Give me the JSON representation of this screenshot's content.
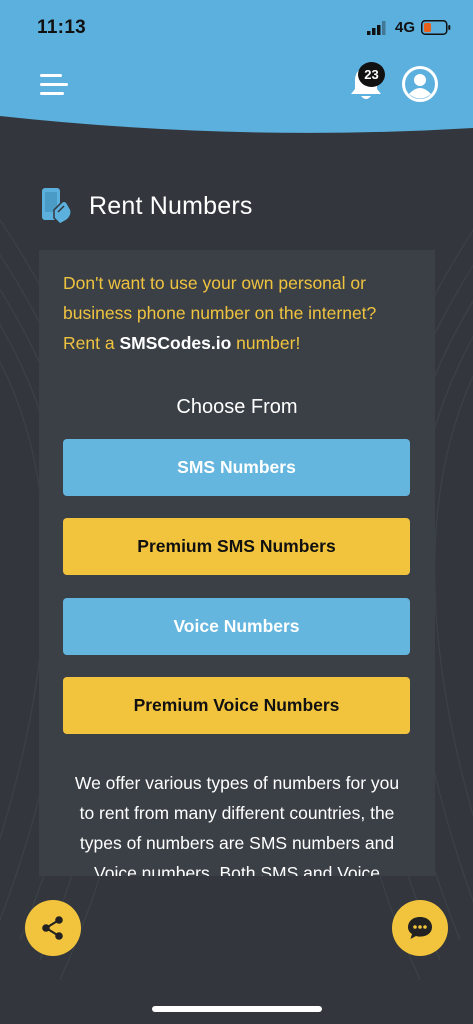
{
  "status_bar": {
    "time": "11:13",
    "network": "4G"
  },
  "header": {
    "notification_count": "23",
    "accent_color": "#5cb0dd"
  },
  "page": {
    "title": "Rent Numbers"
  },
  "card": {
    "intro_line1": "Don't want to use your own personal or",
    "intro_line2": "business phone number on the internet?",
    "intro_prefix": "Rent a ",
    "intro_brand": "SMSCodes.io",
    "intro_suffix": " number!",
    "choose_title": "Choose From",
    "buttons": [
      {
        "label": "SMS Numbers",
        "color": "#64b6de"
      },
      {
        "label": "Premium SMS Numbers",
        "color": "#f2c43d"
      },
      {
        "label": "Voice Numbers",
        "color": "#64b6de"
      },
      {
        "label": "Premium Voice Numbers",
        "color": "#f2c43d"
      }
    ],
    "description_line1": "We offer various types of numbers for you",
    "description_line2": "to rent from many different countries, the",
    "description_line3": "types of numbers are SMS numbers and",
    "description_line4": "Voice numbers. Both SMS and Voice"
  },
  "fabs": {
    "share_icon": "share-icon",
    "chat_icon": "chat-icon"
  }
}
